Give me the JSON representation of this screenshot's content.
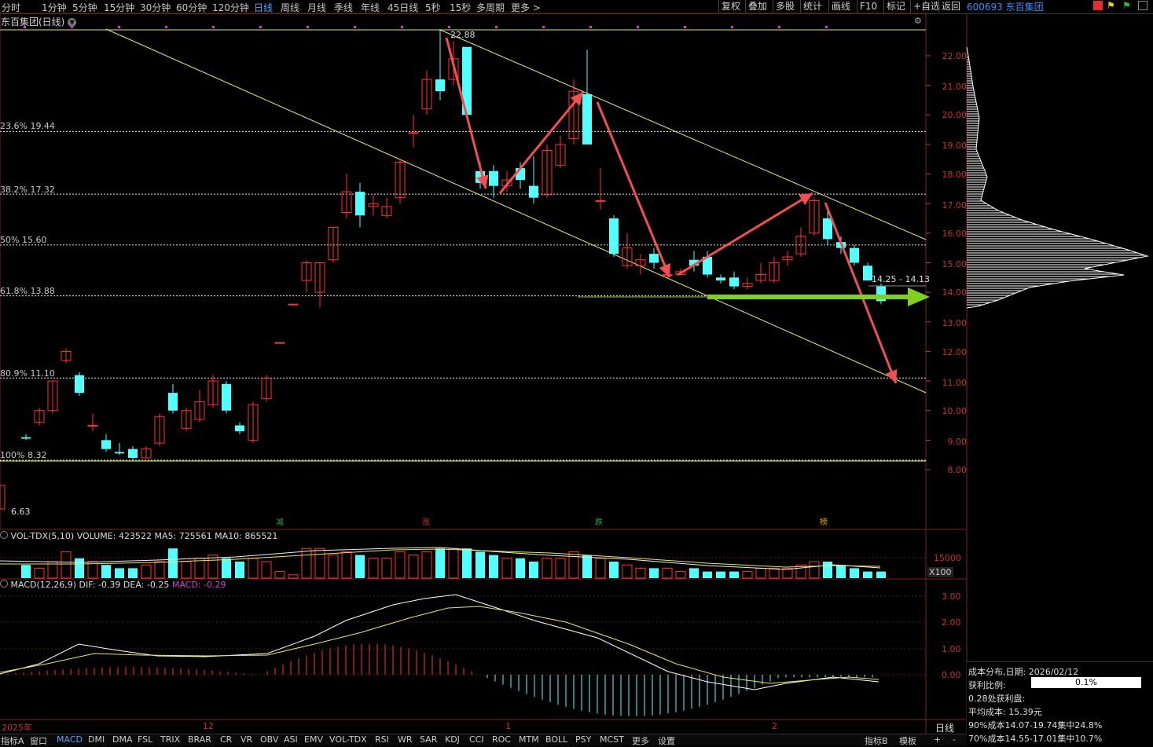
{
  "toolbar": {
    "periods": [
      "分时",
      "1分钟",
      "5分钟",
      "15分钟",
      "30分钟",
      "60分钟",
      "120分钟",
      "日线",
      "周线",
      "月线",
      "季线",
      "年线",
      "45日线",
      "5秒",
      "15秒",
      "多周期",
      "更多 >"
    ],
    "active_period": "日线",
    "right_buttons": [
      "复权",
      "叠加",
      "多股",
      "统计",
      "画线",
      "F10",
      "标记",
      "+自选",
      "返回"
    ],
    "stock_code_name": "600693 东百集团"
  },
  "chart_title": "东百集团(日线)",
  "fib_levels": [
    {
      "label": "23.6% 19.44",
      "price": 19.44
    },
    {
      "label": "38.2% 17.32",
      "price": 17.32
    },
    {
      "label": "50% 15.60",
      "price": 15.6
    },
    {
      "label": "61.8% 13.88",
      "price": 13.88
    },
    {
      "label": "80.9% 11.10",
      "price": 11.1
    },
    {
      "label": "100% 8.32",
      "price": 8.32
    }
  ],
  "price_axis_labels": [
    "22.00",
    "21.00",
    "20.00",
    "19.00",
    "18.00",
    "17.00",
    "16.00",
    "15.00",
    "14.00",
    "13.00",
    "12.00",
    "11.00",
    "10.00",
    "9.00",
    "8.00"
  ],
  "annotations": {
    "high_label": "22.88",
    "low_label": "6.63",
    "price_range_label": "14.25 - 14.13"
  },
  "event_markers": [
    {
      "text": "减",
      "color": "#1fa84a"
    },
    {
      "text": "涨",
      "color": "#c83232"
    },
    {
      "text": "跌",
      "color": "#1fa84a"
    },
    {
      "text": "榜",
      "color": "#d8a800"
    }
  ],
  "volume_indicator": {
    "name": "VOL-TDX(5,10)",
    "volume": "VOLUME: 423522",
    "ma5": "MA5: 725561",
    "ma10": "MA10: 865521",
    "axis_label": "15000",
    "unit": "X100"
  },
  "macd_indicator": {
    "name": "MACD(12,26,9)",
    "dif": "DIF: -0.39",
    "dea": "DEA: -0.25",
    "macd": "MACD: -0.29",
    "axis_labels": [
      "3.00",
      "2.00",
      "1.00",
      "0.00"
    ]
  },
  "date_axis": [
    "2025年",
    "12",
    "1",
    "2"
  ],
  "period_side_label": "日线",
  "bottom_tabs": [
    "指标A",
    "窗口",
    "MACD",
    "DMI",
    "DMA",
    "FSL",
    "TRIX",
    "BRAR",
    "CR",
    "VR",
    "OBV",
    "ASI",
    "EMV",
    "VOL-TDX",
    "RSI",
    "WR",
    "SAR",
    "KDJ",
    "CCI",
    "ROC",
    "MTM",
    "BOLL",
    "PSY",
    "MCST",
    "更多",
    "设置"
  ],
  "bottom_active": "MACD",
  "bottom_right": [
    "指标B",
    "模板",
    "+",
    "-"
  ],
  "cost_panel": {
    "title": "成本分布,日期: 2026/02/12",
    "profit_ratio_label": "获利比例:",
    "profit_ratio_value": "0.1%",
    "profit_line": "0.28处获利盘:",
    "avg_cost": "平均成本: 15.39元",
    "c90": "90%成本14.07-19.74集中24.8%",
    "c70": "70%成本14.55-17.01集中10.7%"
  },
  "colors": {
    "up": "#ff3232",
    "down": "#54ffff",
    "accent": "#4fa6ff",
    "arrow_red": "#f05050",
    "arrow_green": "#7fd020"
  }
}
